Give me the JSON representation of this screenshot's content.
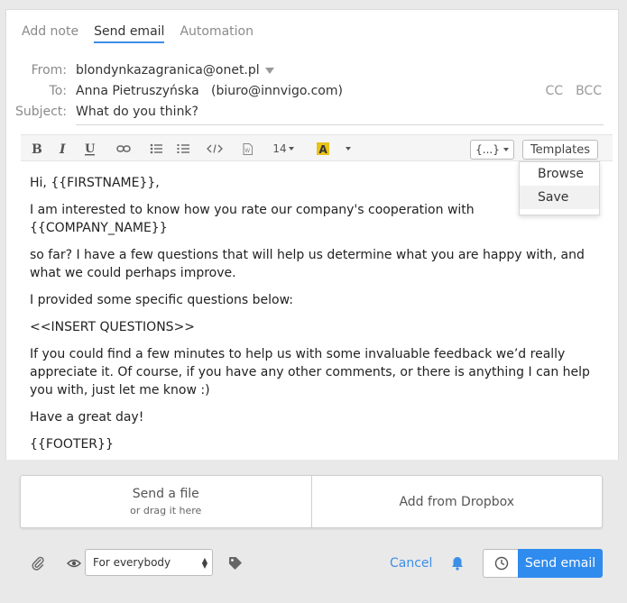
{
  "tabs": [
    "Add note",
    "Send email",
    "Automation"
  ],
  "from": {
    "label": "From:",
    "value": "blondynkazagranica@onet.pl"
  },
  "to": {
    "label": "To:",
    "name": "Anna Pietruszyńska",
    "email": "(biuro@innvigo.com)"
  },
  "cc_label": "CC",
  "bcc_label": "BCC",
  "subject": {
    "label": "Subject:",
    "value": "What do you think?"
  },
  "toolbar": {
    "font_size": "14",
    "variables_label": "{...}",
    "templates_label": "Templates"
  },
  "templates_menu": [
    "Browse",
    "Save"
  ],
  "body": [
    "Hi, {{FIRSTNAME}},",
    "I am interested to know how you rate our company's cooperation with {{COMPANY_NAME}}",
    "so far? I have a few questions that will help us determine what you are happy with, and what we could perhaps improve.",
    "I provided some specific questions below:",
    "<<INSERT QUESTIONS>>",
    "If you could find a few minutes to help us with some invaluable feedback we’d really appreciate it. Of course, if you have any other comments, or there is anything I can help you with, just let me know :)",
    "Have a great day!",
    "{{FOOTER}}"
  ],
  "attach": {
    "file_title": "Send a file",
    "file_sub": "or drag it here",
    "dropbox": "Add from Dropbox"
  },
  "visibility": "For everybody",
  "cancel_label": "Cancel",
  "send_label": "Send email",
  "colors": {
    "accent": "#3d8ee8",
    "send_bg": "#2f8bee",
    "highlight": "#e8c21a"
  }
}
